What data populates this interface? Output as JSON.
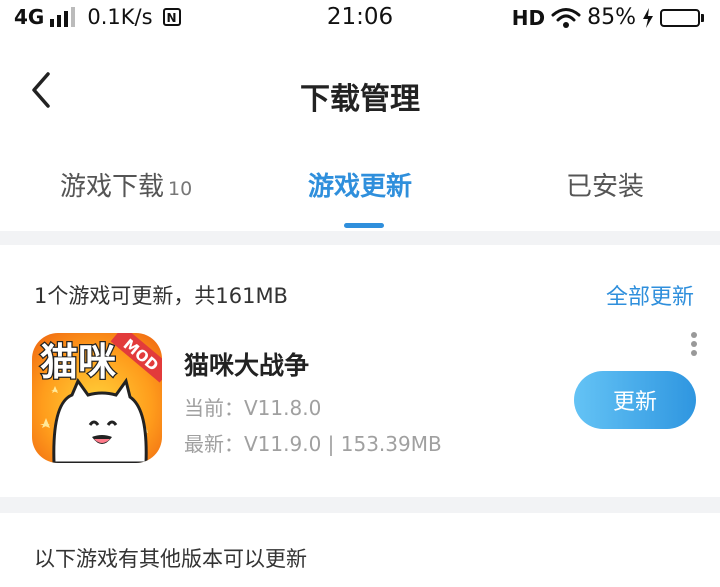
{
  "status_bar": {
    "network": "4G",
    "speed": "0.1K/s",
    "time": "21:06",
    "hd": "HD",
    "battery": "85%",
    "battery_level": 0.85
  },
  "header": {
    "title": "下载管理"
  },
  "tabs": [
    {
      "label": "游戏下载",
      "count": "10",
      "active": false
    },
    {
      "label": "游戏更新",
      "count": "",
      "active": true
    },
    {
      "label": "已安装",
      "count": "",
      "active": false
    }
  ],
  "update_section": {
    "summary": "1个游戏可更新，共161MB",
    "update_all": "全部更新",
    "app": {
      "name": "猫咪大战争",
      "current": "当前：V11.8.0",
      "latest": "最新：V11.9.0 | 153.39MB",
      "update_button": "更新",
      "icon_text": "猫咪",
      "icon_badge": "MOD"
    }
  },
  "other_versions": {
    "title": "以下游戏有其他版本可以更新"
  },
  "colors": {
    "accent": "#2f8fdc",
    "divider": "#f2f3f5"
  }
}
